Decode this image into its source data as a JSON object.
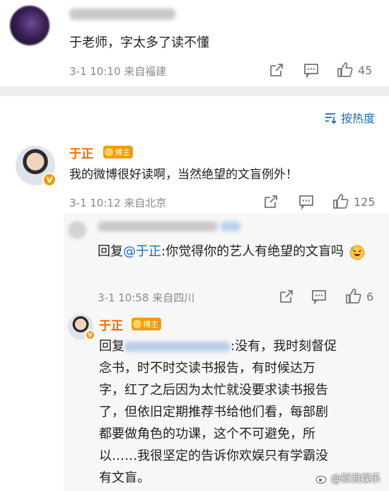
{
  "top_comment": {
    "text": "于老师，字太多了读不懂",
    "meta": "3-1 10:10 来自福建",
    "likes": "45"
  },
  "sort": {
    "label": "按热度"
  },
  "main_comment": {
    "author": "于正",
    "badge": "博主",
    "verified": "V",
    "text": "我的微博很好读啊，当然绝望的文盲例外！",
    "meta": "3-1 10:12 来自北京",
    "likes": "125"
  },
  "reply1": {
    "prefix": "回复",
    "mention": "@于正",
    "text_rest": ":你觉得你的艺人有绝望的文盲吗",
    "emoji": "laughing-face",
    "meta": "3-1 10:58 来自四川",
    "likes": "6"
  },
  "reply2": {
    "author": "于正",
    "badge": "博主",
    "prefix": "回复",
    "text_tail": ":没有，我时刻督促",
    "lines": [
      "念书，时不时交读书报告，有时候达万",
      "字，红了之后因为太忙就没要求读书报告",
      "了，但依旧定期推荐书给他们看，每部剧",
      "都要做角色的功课，这个不可避免，所",
      "以……我很坚定的告诉你欢娱只有学霸没",
      "有文盲。"
    ]
  },
  "watermark": {
    "text": "@新浪娱乐"
  },
  "colors": {
    "accent_blue": "#1a6ac2",
    "author_orange": "#f26c00",
    "badge_orange": "#f59b00"
  }
}
